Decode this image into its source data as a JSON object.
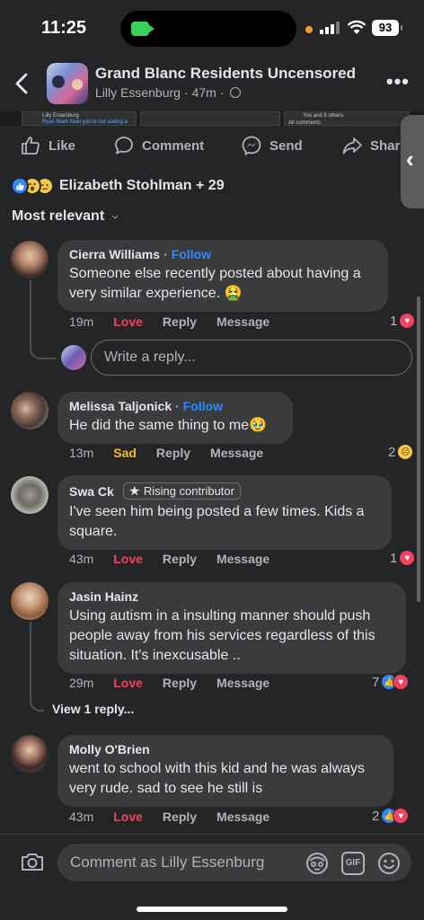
{
  "status_bar": {
    "time": "11:25",
    "battery": "93"
  },
  "header": {
    "group_name": "Grand Blanc Residents Uncensored",
    "author": "Lilly Essenburg",
    "age": "47m",
    "separator": "·"
  },
  "strip": {
    "card1_name": "Lilly Essenburg",
    "card1_text": "Ryan Mark Noel you're not asking a",
    "card3_text": "You and 6 others",
    "card3_text2": "All comments"
  },
  "actions": {
    "like": "Like",
    "comment": "Comment",
    "send": "Send",
    "share": "Share"
  },
  "reactions": {
    "text": "Elizabeth Stohlman + 29"
  },
  "sort": {
    "label": "Most relevant"
  },
  "reply_placeholder": "Write a reply...",
  "view_replies": "View 1 reply...",
  "comments": [
    {
      "name": "Cierra Williams",
      "follow": "Follow",
      "text_lines": [
        "Someone else recently posted about having a",
        "very similar experience. 🤮"
      ],
      "time": "19m",
      "reaction": "Love",
      "reply": "Reply",
      "message": "Message",
      "count": "1"
    },
    {
      "name": "Melissa Taljonick",
      "follow": "Follow",
      "text_lines": [
        "He did the same thing to me🥹"
      ],
      "time": "13m",
      "reaction": "Sad",
      "reply": "Reply",
      "message": "Message",
      "count": "2"
    },
    {
      "name": "Swa Ck",
      "badge": "Rising contributor",
      "text_lines": [
        "I've seen him being posted a few times. Kids a",
        "square."
      ],
      "time": "43m",
      "reaction": "Love",
      "reply": "Reply",
      "message": "Message",
      "count": "1"
    },
    {
      "name": "Jasin Hainz",
      "text_lines": [
        "Using autism in a insulting manner should push",
        "people away from his services regardless of this",
        "situation. It's inexcusable .."
      ],
      "time": "29m",
      "reaction": "Love",
      "reply": "Reply",
      "message": "Message",
      "count": "7"
    },
    {
      "name": "Molly O'Brien",
      "text_lines": [
        "went to school with this kid and he was always",
        "very rude. sad to see he still is"
      ],
      "time": "43m",
      "reaction": "Love",
      "reply": "Reply",
      "message": "Message",
      "count": "2"
    }
  ],
  "composer": {
    "placeholder": "Comment as Lilly Essenburg",
    "gif_label": "GIF"
  },
  "colors": {
    "background": "#242526",
    "bubble": "#3a3b3c",
    "link_blue": "#2e89ff",
    "love_red": "#f3425f",
    "sad_yellow": "#f7b928"
  },
  "icons": [
    "back-icon",
    "more-icon",
    "globe-icon",
    "like-icon",
    "comment-icon",
    "messenger-icon",
    "share-icon",
    "camera-icon",
    "avatar-sticker-icon",
    "gif-icon",
    "emoji-icon",
    "heart-icon",
    "thumb-icon",
    "sad-icon",
    "star-icon"
  ]
}
